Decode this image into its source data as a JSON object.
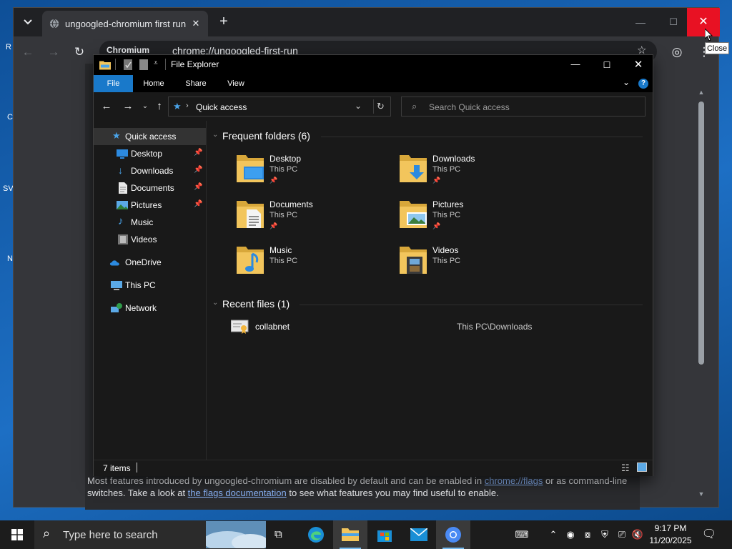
{
  "desktop": {
    "frags": [
      "R",
      "C",
      "SV",
      "N"
    ]
  },
  "chrome": {
    "tab_title": "ungoogled-chromium first run",
    "omnibox_chip": "Chromium",
    "omnibox_url": "chrome://ungoogled-first-run",
    "tooltip": "Close",
    "footer": {
      "t1": "Most features introduced by ungoogled-chromium are disabled by default and can be enabled in ",
      "link1": "chrome://flags",
      "t2": " or as command-line switches. Take a look at ",
      "link2": "the flags documentation",
      "t3": " to see what features you may find useful to enable."
    }
  },
  "explorer": {
    "title": "File Explorer",
    "ribbon_tabs": [
      "File",
      "Home",
      "Share",
      "View"
    ],
    "address": "Quick access",
    "search_placeholder": "Search Quick access",
    "nav": {
      "quick_access": "Quick access",
      "items": [
        {
          "label": "Desktop",
          "pinned": true
        },
        {
          "label": "Downloads",
          "pinned": true
        },
        {
          "label": "Documents",
          "pinned": true
        },
        {
          "label": "Pictures",
          "pinned": true
        },
        {
          "label": "Music",
          "pinned": false
        },
        {
          "label": "Videos",
          "pinned": false
        }
      ],
      "onedrive": "OneDrive",
      "this_pc": "This PC",
      "network": "Network"
    },
    "frequent_header": "Frequent folders (6)",
    "folders": [
      {
        "name": "Desktop",
        "location": "This PC",
        "pinned": true,
        "icon": "desktop-folder-icon"
      },
      {
        "name": "Downloads",
        "location": "This PC",
        "pinned": true,
        "icon": "downloads-folder-icon"
      },
      {
        "name": "Documents",
        "location": "This PC",
        "pinned": true,
        "icon": "documents-folder-icon"
      },
      {
        "name": "Pictures",
        "location": "This PC",
        "pinned": true,
        "icon": "pictures-folder-icon"
      },
      {
        "name": "Music",
        "location": "This PC",
        "pinned": false,
        "icon": "music-folder-icon"
      },
      {
        "name": "Videos",
        "location": "This PC",
        "pinned": false,
        "icon": "videos-folder-icon"
      }
    ],
    "recent_header": "Recent files (1)",
    "recent": [
      {
        "name": "collabnet",
        "path": "This PC\\Downloads"
      }
    ],
    "status": "7 items"
  },
  "taskbar": {
    "search_placeholder": "Type here to search",
    "apps": [
      "task-view",
      "edge",
      "file-explorer",
      "store",
      "mail",
      "chromium"
    ],
    "time": "9:17 PM",
    "date": "11/20/2025"
  },
  "colors": {
    "accent": "#1979ca",
    "close_red": "#e81123",
    "link": "#8ab4f8",
    "folder_yellow": "#f2c55c"
  }
}
